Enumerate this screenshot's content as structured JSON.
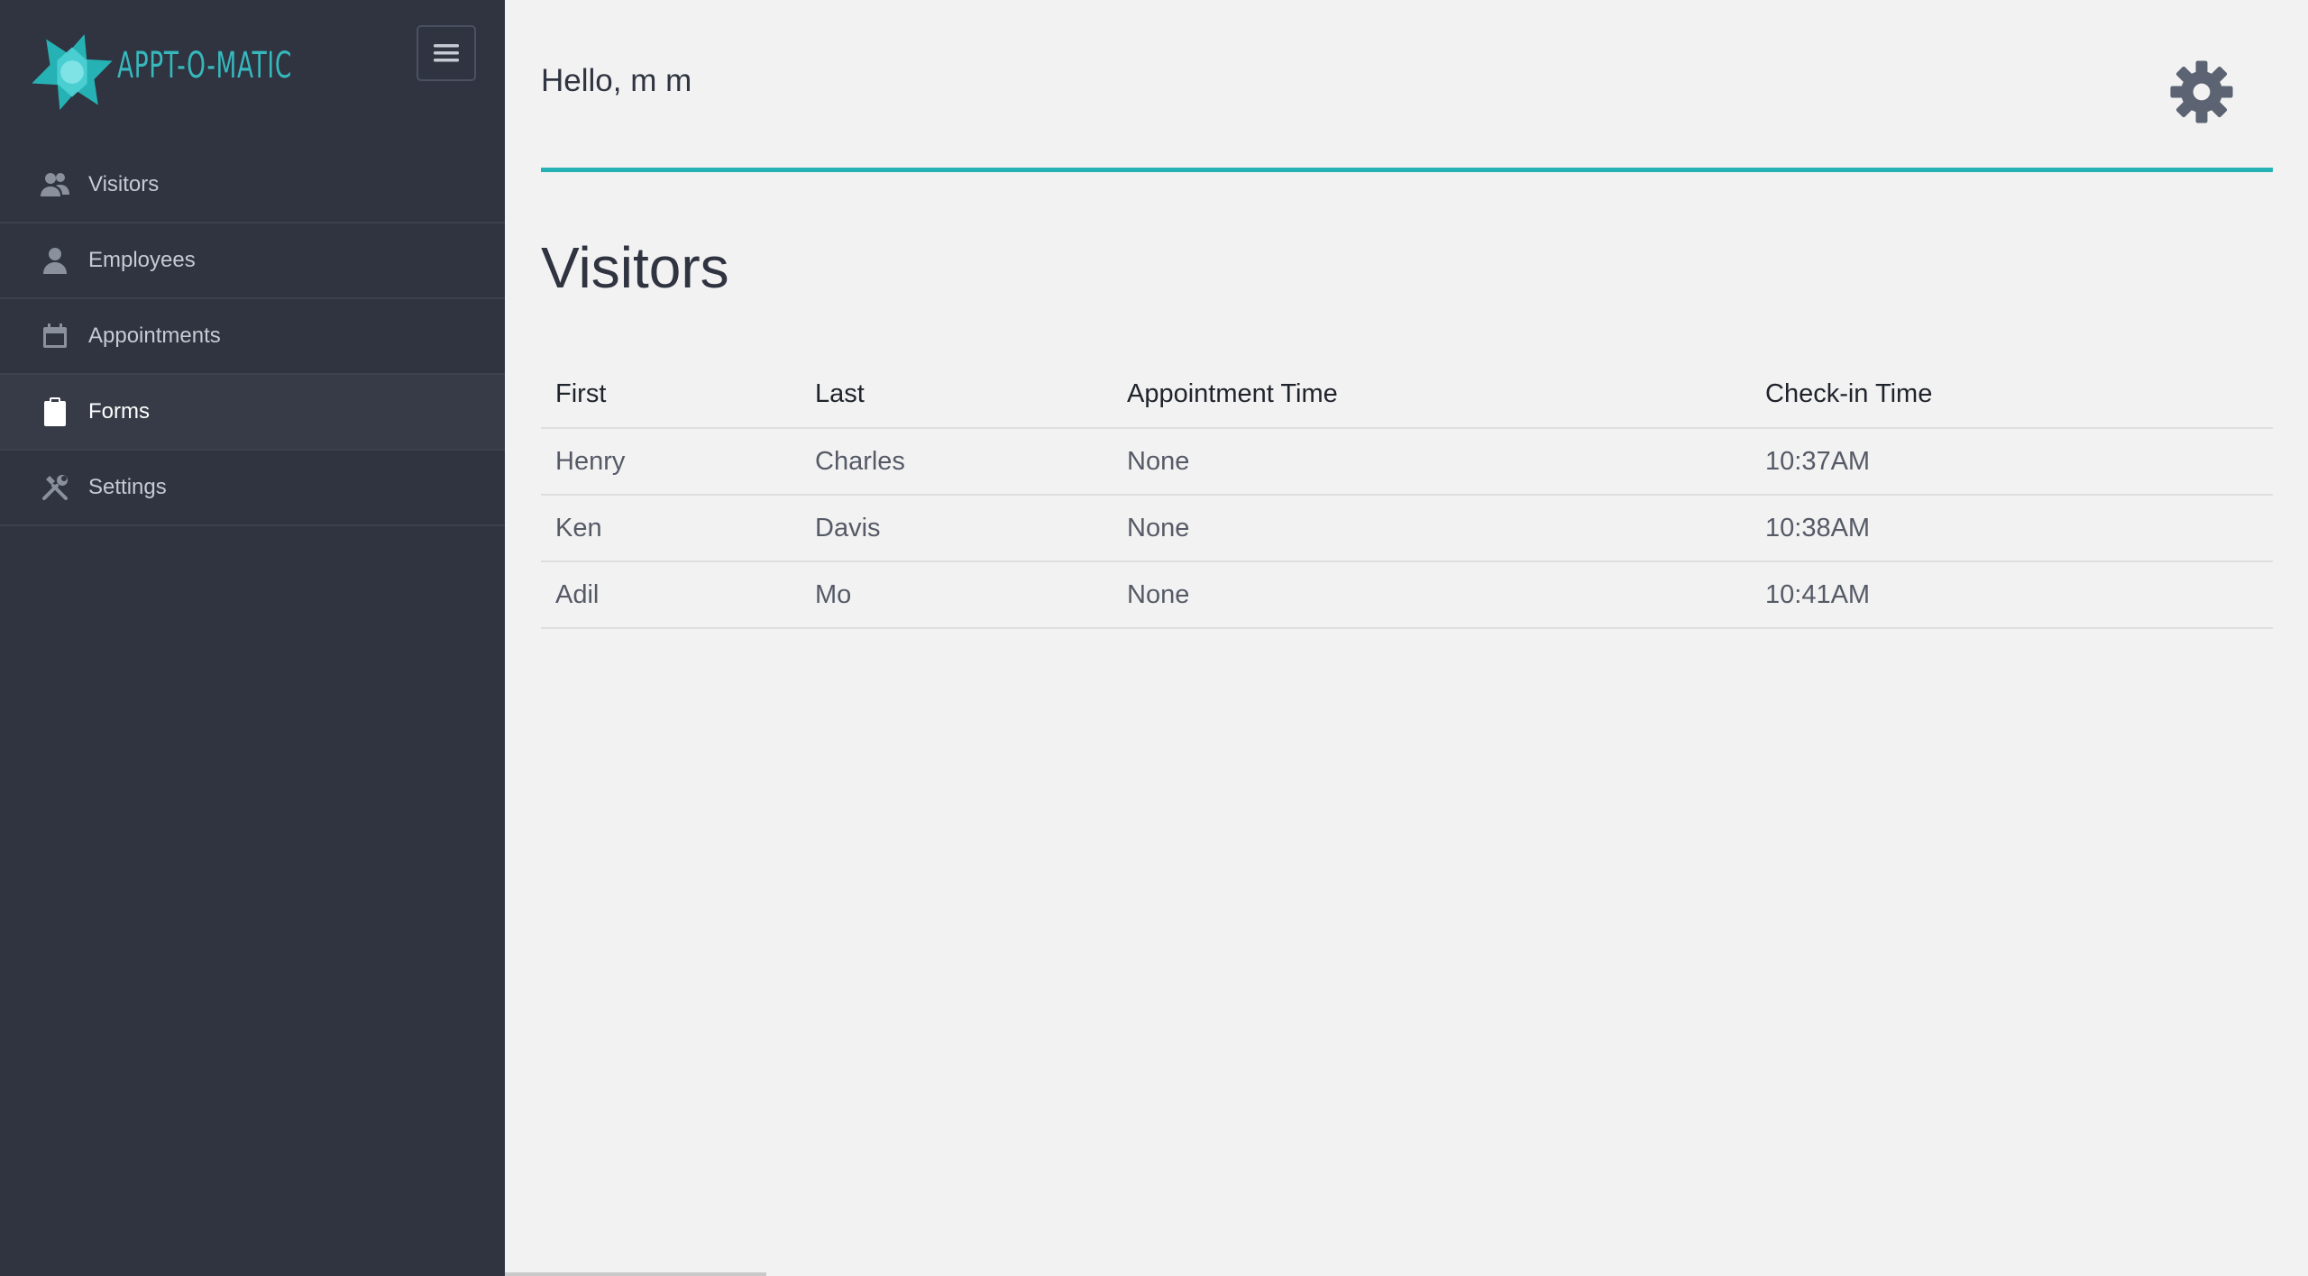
{
  "app": {
    "brand_name": "APPT-O-MATIC",
    "accent_color": "#26b2b4"
  },
  "header": {
    "greeting": "Hello, m m"
  },
  "sidebar": {
    "items": [
      {
        "label": "Visitors",
        "icon": "users-icon",
        "active": false
      },
      {
        "label": "Employees",
        "icon": "user-icon",
        "active": false
      },
      {
        "label": "Appointments",
        "icon": "calendar-icon",
        "active": false
      },
      {
        "label": "Forms",
        "icon": "clipboard-icon",
        "active": true
      },
      {
        "label": "Settings",
        "icon": "tools-icon",
        "active": false
      }
    ]
  },
  "main": {
    "title": "Visitors",
    "table": {
      "columns": [
        "First",
        "Last",
        "Appointment Time",
        "Check-in Time"
      ],
      "rows": [
        [
          "Henry",
          "Charles",
          "None",
          "10:37AM"
        ],
        [
          "Ken",
          "Davis",
          "None",
          "10:38AM"
        ],
        [
          "Adil",
          "Mo",
          "None",
          "10:41AM"
        ]
      ]
    }
  }
}
